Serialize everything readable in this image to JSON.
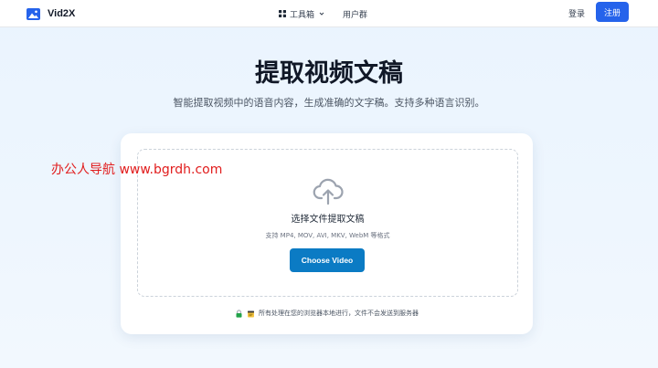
{
  "header": {
    "brand": "Vid2X",
    "nav": {
      "tools_label": "工具箱",
      "users_label": "用户群"
    },
    "login_label": "登录",
    "signup_label": "注册"
  },
  "hero": {
    "title": "提取视频文稿",
    "subtitle": "智能提取视频中的语音内容，生成准确的文字稿。支持多种语言识别。"
  },
  "upload": {
    "title": "选择文件提取文稿",
    "formats": "支持 MP4, MOV, AVI, MKV, WebM 等格式",
    "button_label": "Choose Video",
    "privacy_text": "所有处理在您的浏览器本地进行，文件不会发送到服务器"
  },
  "watermark": "办公人导航  www.bgrdh.com",
  "colors": {
    "primary": "#2563eb",
    "choose_button": "#0b7bc4",
    "watermark": "#e11d1d"
  },
  "icons": {
    "logo": "image-icon",
    "tools": "grid-icon",
    "dropdown": "chevron-down-icon",
    "upload": "cloud-upload-icon",
    "privacy": [
      "lock-icon",
      "notepad-icon"
    ]
  }
}
